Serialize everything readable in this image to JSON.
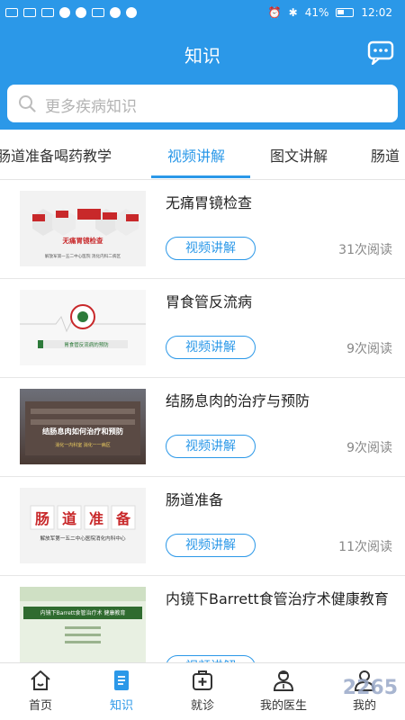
{
  "status_bar": {
    "battery": "41%",
    "time": "12:02"
  },
  "header": {
    "title": "知识"
  },
  "search": {
    "placeholder": "更多疾病知识"
  },
  "tabs": [
    {
      "label": "肠道准备喝药教学"
    },
    {
      "label": "视频讲解"
    },
    {
      "label": "图文讲解"
    },
    {
      "label": "肠道"
    }
  ],
  "items": [
    {
      "title": "无痛胃镜检查",
      "badge": "视频讲解",
      "reads": "31次阅读",
      "thumb": {
        "lines": [
          "无痛胃镜检查",
          "解放军第一五二中心医院  消化内科二病区"
        ],
        "chips": [
          "精准",
          "安全",
          "舒适",
          "满意"
        ]
      }
    },
    {
      "title": "胃食管反流病",
      "badge": "视频讲解",
      "reads": "9次阅读",
      "thumb": {
        "lines": [
          "胃食管反流病的预防"
        ]
      }
    },
    {
      "title": "结肠息肉的治疗与预防",
      "badge": "视频讲解",
      "reads": "9次阅读",
      "thumb": {
        "lines": [
          "结肠息肉如何治疗和预防",
          "消化一内科室  消化一一病区"
        ]
      }
    },
    {
      "title": "肠道准备",
      "badge": "视频讲解",
      "reads": "11次阅读",
      "thumb": {
        "chars": [
          "肠",
          "道",
          "准",
          "备"
        ],
        "lines": [
          "解放军第一五二中心医院消化内科中心"
        ]
      }
    },
    {
      "title": "内镜下Barrett食管治疗术健康教育",
      "badge": "视频讲解",
      "reads": "",
      "thumb": {
        "lines": [
          "内镜下Barrett食管治疗术 健康教育"
        ]
      }
    }
  ],
  "bottom_nav": [
    {
      "label": "首页",
      "icon": "home-icon"
    },
    {
      "label": "知识",
      "icon": "book-icon"
    },
    {
      "label": "就诊",
      "icon": "medical-kit-icon"
    },
    {
      "label": "我的医生",
      "icon": "doctor-icon"
    },
    {
      "label": "我的",
      "icon": "user-icon"
    }
  ],
  "watermark": {
    "text": "2265"
  },
  "colors": {
    "primary": "#2b98e8",
    "header_bg": "#2b98e8",
    "text": "#222222",
    "muted": "#888888"
  }
}
